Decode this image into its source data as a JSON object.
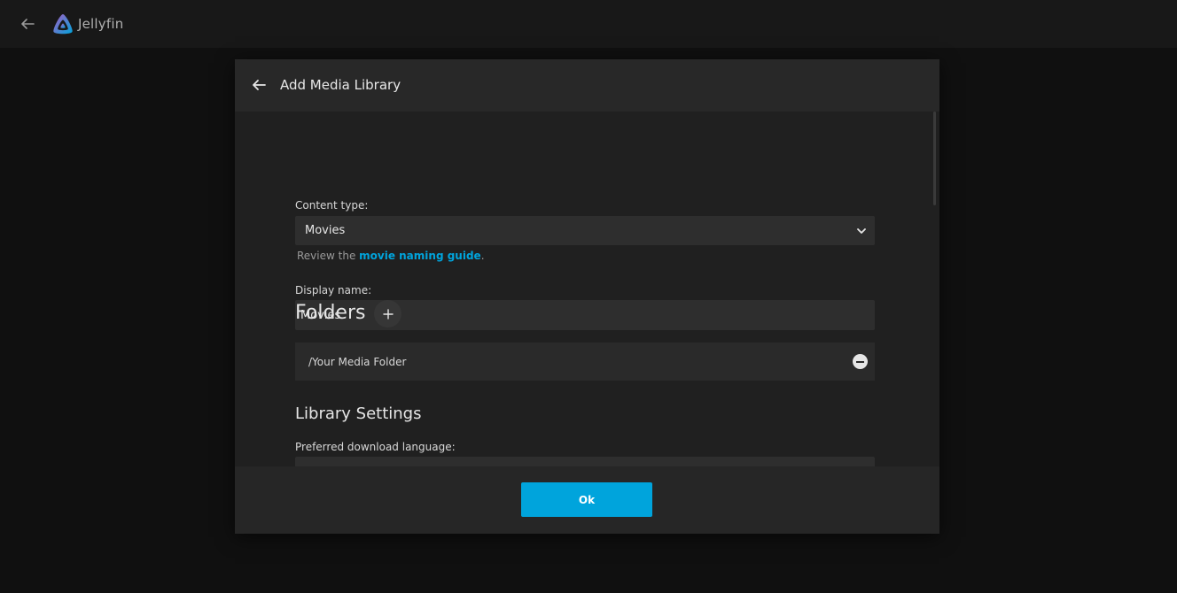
{
  "app": {
    "name": "Jellyfin",
    "accent_color": "#00a4dc",
    "logo_icon": "jellyfin-logo-icon"
  },
  "dialog": {
    "title": "Add Media Library",
    "content_type": {
      "label": "Content type:",
      "selected": "Movies",
      "hint_prefix": "Review the ",
      "hint_link": "movie naming guide",
      "hint_suffix": "."
    },
    "display_name": {
      "label": "Display name:",
      "value": "Movies"
    },
    "folders": {
      "title": "Folders",
      "items": [
        {
          "path": "/Your Media Folder"
        }
      ]
    },
    "library_settings": {
      "title": "Library Settings",
      "download_language_label": "Preferred download language:"
    },
    "ok_label": "Ok"
  }
}
